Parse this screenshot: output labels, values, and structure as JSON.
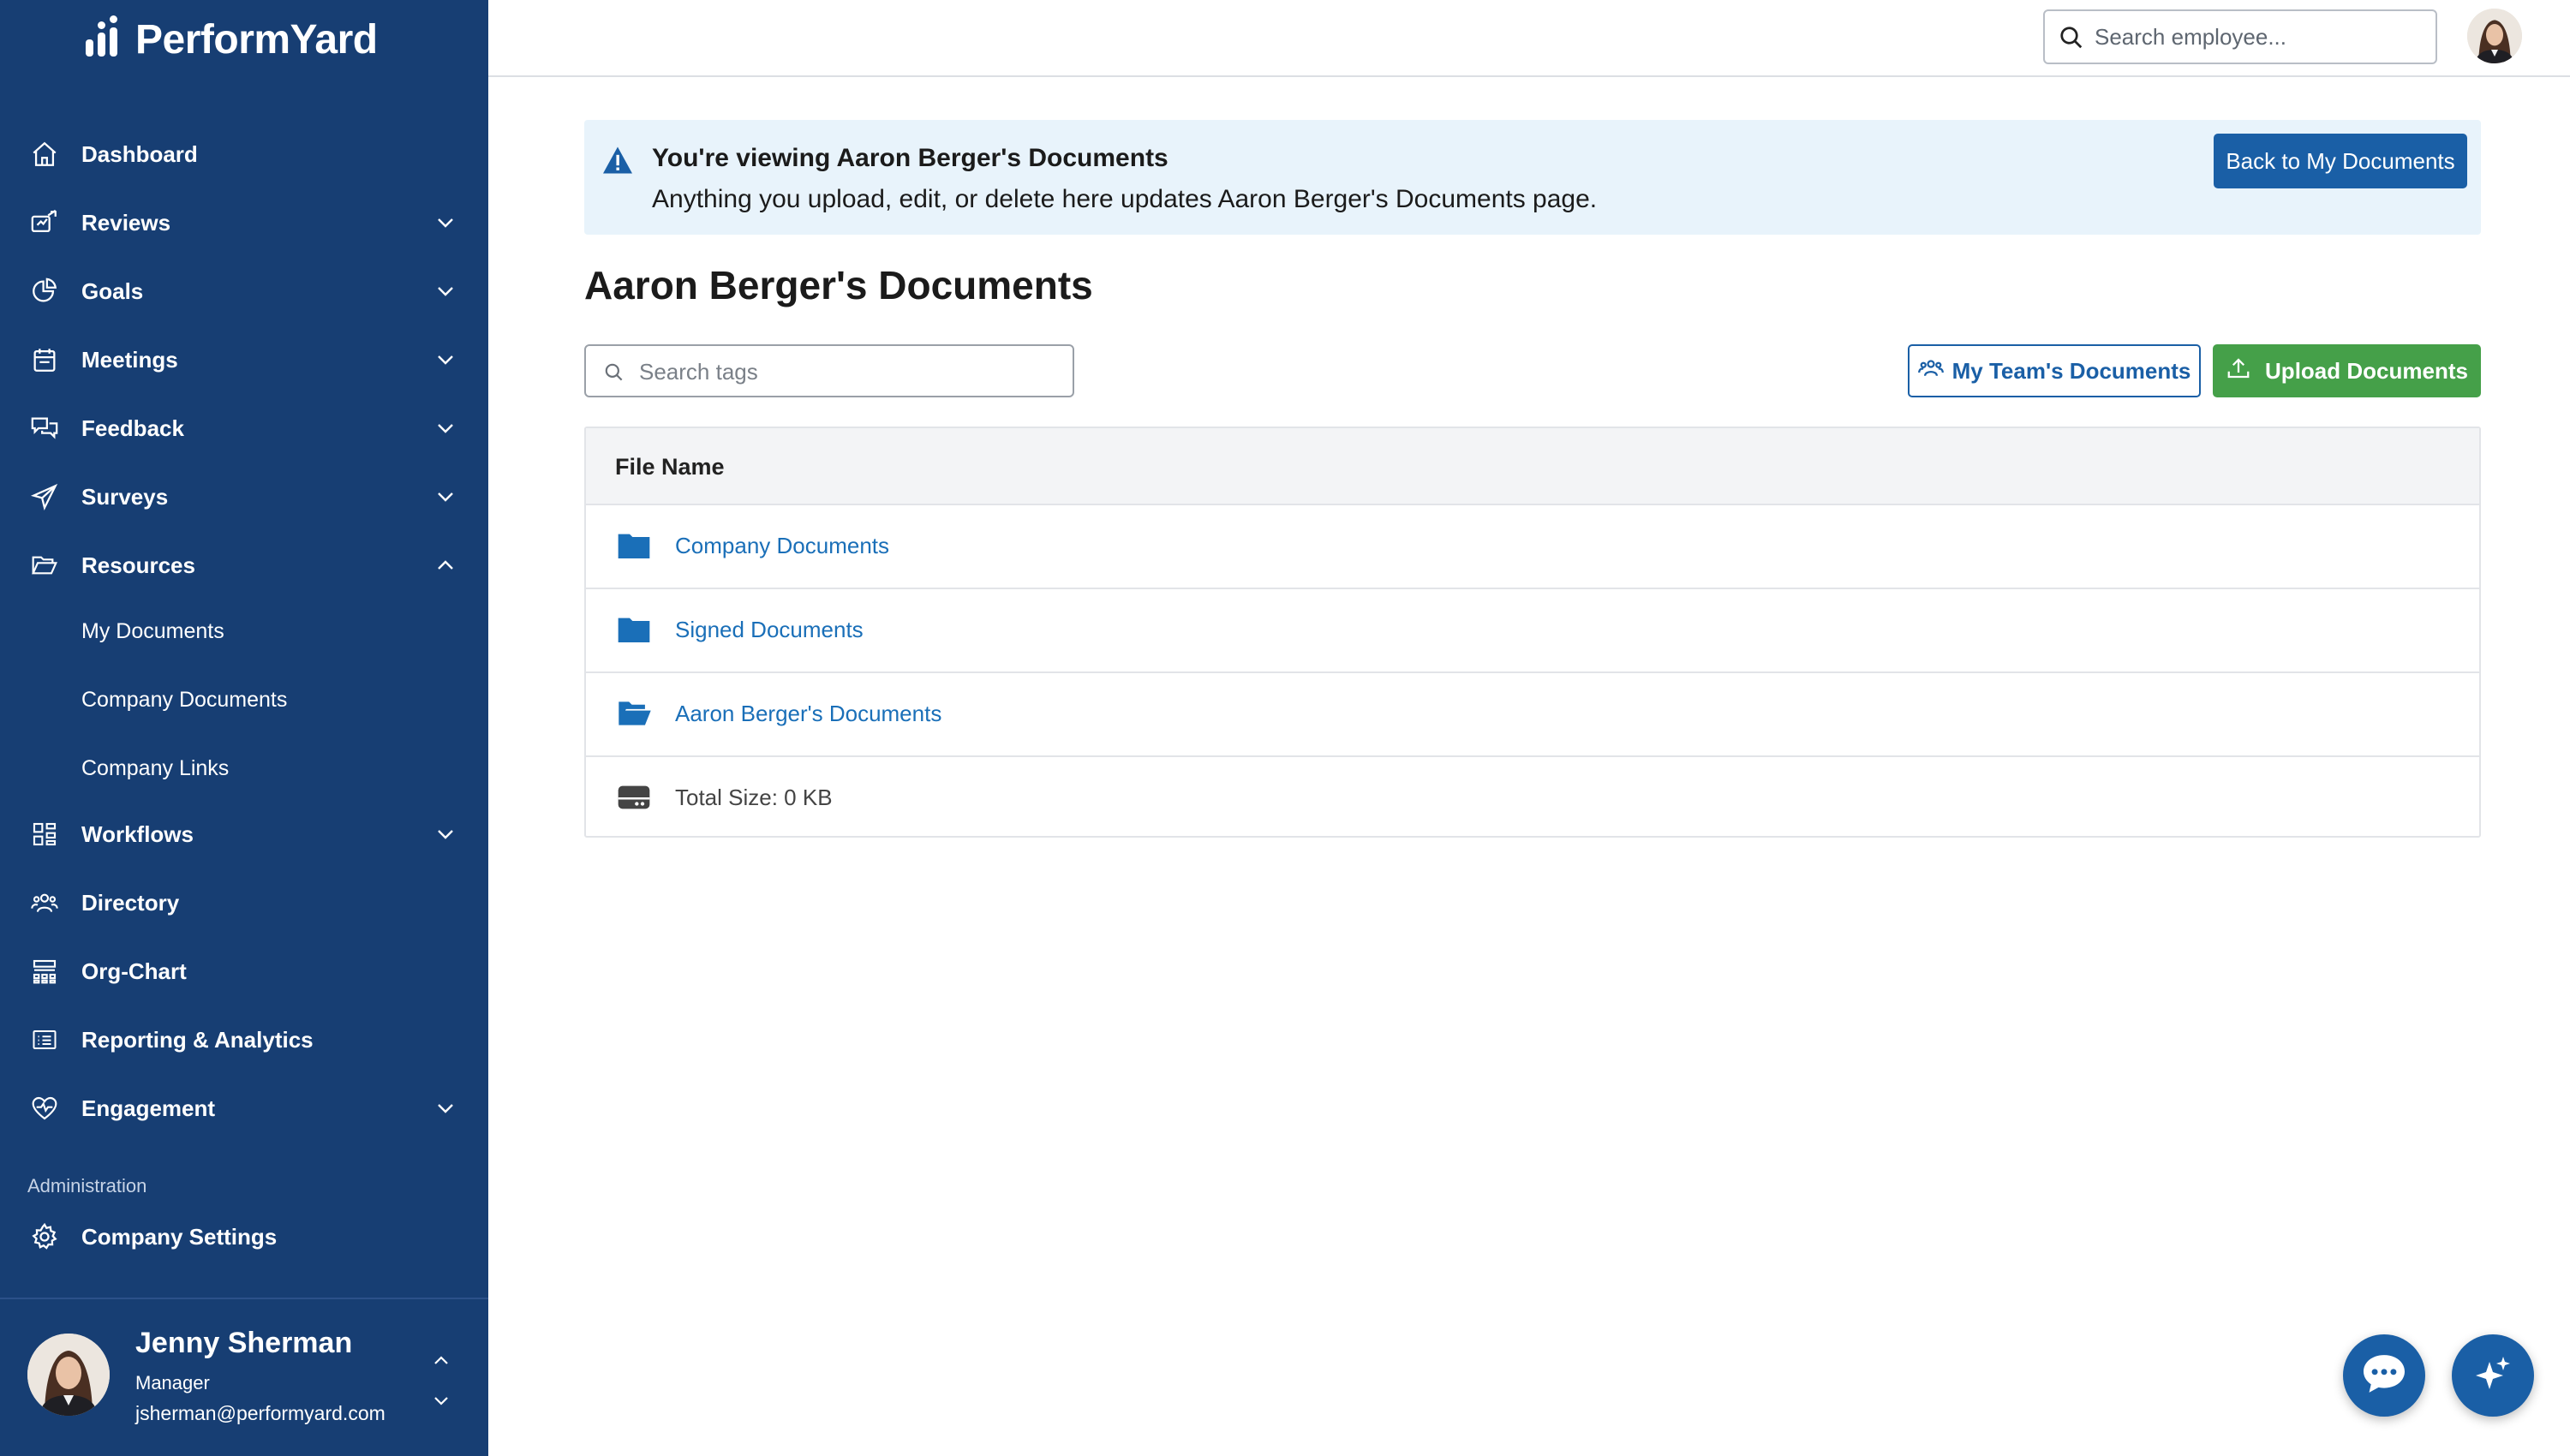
{
  "brand": {
    "name": "PerformYard"
  },
  "sidebar": {
    "items": [
      {
        "label": "Dashboard",
        "icon": "home-icon"
      },
      {
        "label": "Reviews",
        "icon": "reviews-icon"
      },
      {
        "label": "Goals",
        "icon": "goals-pie-icon"
      },
      {
        "label": "Meetings",
        "icon": "calendar-icon"
      },
      {
        "label": "Feedback",
        "icon": "chat-bubbles-icon"
      },
      {
        "label": "Surveys",
        "icon": "paper-plane-icon"
      },
      {
        "label": "Resources",
        "icon": "folder-open-icon",
        "expanded": true
      },
      {
        "label": "Workflows",
        "icon": "workflow-grid-icon"
      },
      {
        "label": "Directory",
        "icon": "people-icon"
      },
      {
        "label": "Org-Chart",
        "icon": "org-chart-icon"
      },
      {
        "label": "Reporting & Analytics",
        "icon": "report-list-icon"
      },
      {
        "label": "Engagement",
        "icon": "heart-pulse-icon"
      }
    ],
    "resources_sub": [
      "My Documents",
      "Company Documents",
      "Company Links"
    ],
    "admin_label": "Administration",
    "company_settings": "Company Settings",
    "user": {
      "name": "Jenny Sherman",
      "role": "Manager",
      "email": "jsherman@performyard.com"
    }
  },
  "topbar": {
    "search_placeholder": "Search employee..."
  },
  "banner": {
    "title": "You're viewing Aaron Berger's Documents",
    "text": "Anything you upload, edit, or delete here updates Aaron Berger's Documents page.",
    "back_button": "Back to My Documents"
  },
  "page": {
    "title": "Aaron Berger's Documents",
    "tag_search_placeholder": "Search tags",
    "team_button": "My Team's Documents",
    "upload_button": "Upload Documents"
  },
  "table": {
    "header": "File Name",
    "rows": [
      {
        "name": "Company Documents",
        "icon": "folder-icon"
      },
      {
        "name": "Signed Documents",
        "icon": "folder-icon"
      },
      {
        "name": "Aaron Berger's Documents",
        "icon": "folder-open-icon"
      }
    ],
    "total_size": "Total Size: 0 KB"
  },
  "colors": {
    "sidebar": "#173e73",
    "primary": "#1a5fa6",
    "upload": "#45a049",
    "banner_bg": "#e8f3fb",
    "link": "#1a6fb8"
  }
}
